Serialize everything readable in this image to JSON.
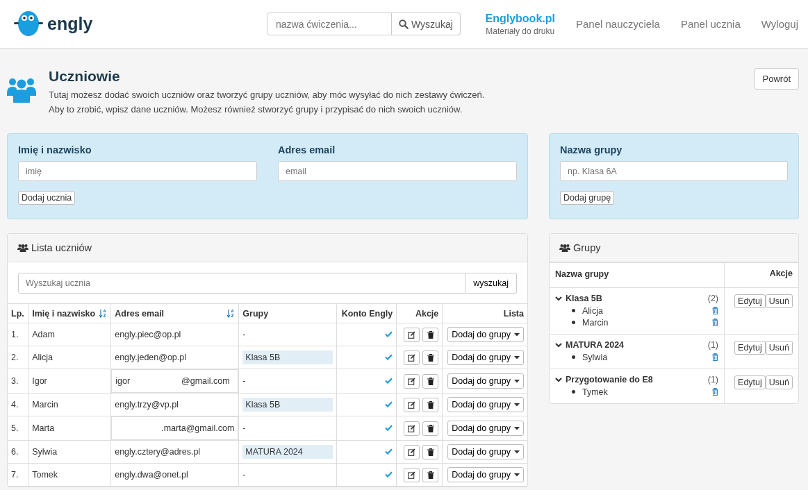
{
  "header": {
    "logo": "engly",
    "search": {
      "placeholder": "nazwa ćwiczenia...",
      "button": "Wyszukaj"
    },
    "nav": [
      {
        "label": "Englybook.pl",
        "sub": "Materiały do druku",
        "kind": "brand"
      },
      {
        "label": "Panel nauczyciela",
        "kind": "link"
      },
      {
        "label": "Panel ucznia",
        "kind": "link"
      },
      {
        "label": "Wyloguj",
        "kind": "link"
      }
    ]
  },
  "page": {
    "title": "Uczniowie",
    "lines": [
      "Tutaj możesz dodać swoich uczniów oraz tworzyć grupy uczniów, aby móc wysyłać do nich zestawy ćwiczeń.",
      "Aby to zrobić, wpisz dane uczniów. Możesz również stworzyć grupy i przypisać do nich swoich uczniów."
    ],
    "back": "Powrót"
  },
  "add_student": {
    "name_label": "Imię i nazwisko",
    "name_placeholder": "imię",
    "email_label": "Adres email",
    "email_placeholder": "email",
    "button": "Dodaj ucznia"
  },
  "add_group": {
    "label": "Nazwa grupy",
    "placeholder": "np. Klasa 6A",
    "button": "Dodaj grupę"
  },
  "students": {
    "title": "Lista uczniów",
    "search_placeholder": "Wyszukaj ucznia",
    "search_button": "wyszukaj",
    "columns": [
      {
        "label": "Lp.",
        "sortable": false
      },
      {
        "label": "Imię i nazwisko",
        "sortable": true
      },
      {
        "label": "Adres email",
        "sortable": true
      },
      {
        "label": "Grupy",
        "sortable": false
      },
      {
        "label": "Konto Engly",
        "sortable": false
      },
      {
        "label": "Akcje",
        "sortable": false
      },
      {
        "label": "Lista",
        "sortable": false
      }
    ],
    "rows": [
      {
        "lp": "1.",
        "name": "Adam",
        "email": "engly.piec@op.pl",
        "group": {
          "name": "-",
          "tagged": false
        },
        "account": true,
        "list_button": "Dodaj do grupy"
      },
      {
        "lp": "2.",
        "name": "Alicja",
        "email": "engly.jeden@op.pl",
        "group": {
          "name": "Klasa 5B",
          "tagged": true
        },
        "account": true,
        "list_button": "Dodaj do grupy"
      },
      {
        "lp": "3.",
        "name": "Igor",
        "redacted": {
          "before": "igor",
          "after": "@gmail.com"
        },
        "group": {
          "name": "-",
          "tagged": false
        },
        "account": true,
        "list_button": "Dodaj do grupy"
      },
      {
        "lp": "4.",
        "name": "Marcin",
        "email": "engly.trzy@vp.pl",
        "group": {
          "name": "Klasa 5B",
          "tagged": true
        },
        "account": true,
        "list_button": "Dodaj do grupy"
      },
      {
        "lp": "5.",
        "name": "Marta",
        "redacted": {
          "after": ".marta@gmail.com"
        },
        "group": {
          "name": "-",
          "tagged": false
        },
        "account": true,
        "list_button": "Dodaj do grupy"
      },
      {
        "lp": "6.",
        "name": "Sylwia",
        "email": "engly.cztery@adres.pl",
        "group": {
          "name": "MATURA 2024",
          "tagged": true
        },
        "account": true,
        "list_button": "Dodaj do grupy"
      },
      {
        "lp": "7.",
        "name": "Tomek",
        "email": "engly.dwa@onet.pl",
        "group": {
          "name": "-",
          "tagged": false
        },
        "account": true,
        "list_button": "Dodaj do grupy"
      }
    ]
  },
  "groups": {
    "title": "Grupy",
    "columns": [
      "Nazwa grupy",
      "Akcje"
    ],
    "items": [
      {
        "name": "Klasa 5B",
        "count": "(2)",
        "expanded": true,
        "members": [
          "Alicja",
          "Marcin"
        ],
        "edit": "Edytuj",
        "delete": "Usuń"
      },
      {
        "name": "MATURA 2024",
        "count": "(1)",
        "expanded": true,
        "members": [
          "Sylwia"
        ],
        "edit": "Edytuj",
        "delete": "Usuń"
      },
      {
        "name": "Przygotowanie do E8",
        "count": "(1)",
        "expanded": true,
        "members": [
          "Tymek"
        ],
        "edit": "Edytuj",
        "delete": "Usuń"
      }
    ]
  }
}
